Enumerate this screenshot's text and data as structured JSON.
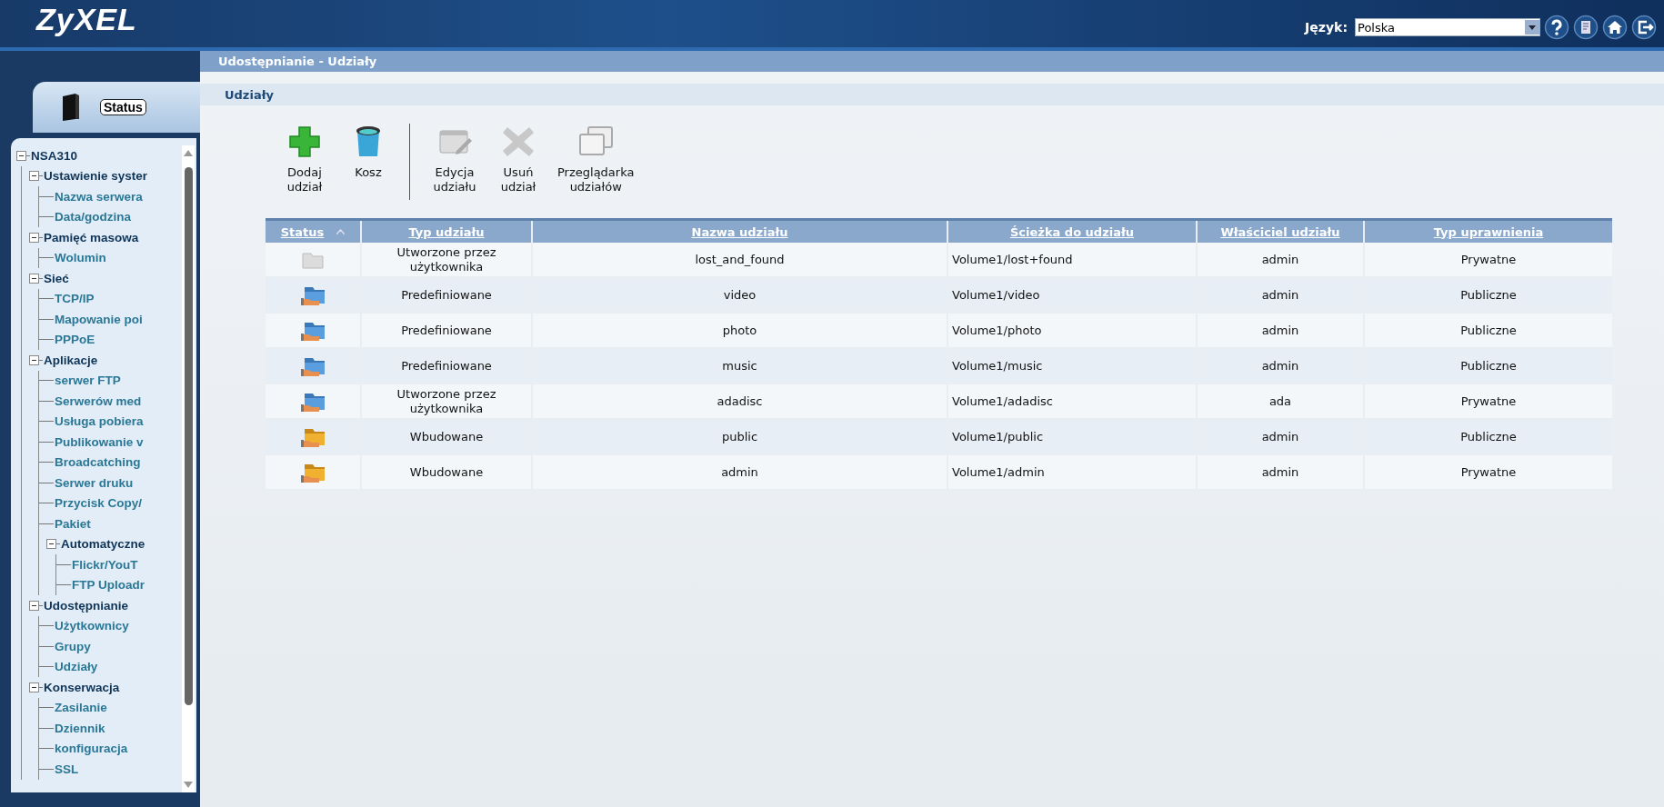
{
  "header": {
    "logo": "ZyXEL",
    "language_label": "Język:",
    "language_value": "Polska"
  },
  "sidebar": {
    "status_tab": "Status",
    "tree": [
      {
        "label": "NSA310",
        "expanded": true,
        "children": [
          {
            "label": "Ustawienie syster",
            "expanded": true,
            "children": [
              {
                "label": "Nazwa serwera"
              },
              {
                "label": "Data/godzina"
              }
            ]
          },
          {
            "label": "Pamięć masowa",
            "expanded": true,
            "children": [
              {
                "label": "Wolumin"
              }
            ]
          },
          {
            "label": "Sieć",
            "expanded": true,
            "children": [
              {
                "label": "TCP/IP"
              },
              {
                "label": "Mapowanie poi"
              },
              {
                "label": "PPPoE"
              }
            ]
          },
          {
            "label": "Aplikacje",
            "expanded": true,
            "children": [
              {
                "label": "serwer FTP"
              },
              {
                "label": "Serwerów med"
              },
              {
                "label": "Usługa pobiera"
              },
              {
                "label": "Publikowanie v"
              },
              {
                "label": "Broadcatching"
              },
              {
                "label": "Serwer druku"
              },
              {
                "label": "Przycisk Copy/"
              },
              {
                "label": "Pakiet"
              },
              {
                "label": "Automatyczne",
                "expanded": true,
                "children": [
                  {
                    "label": "Flickr/YouT"
                  },
                  {
                    "label": "FTP Uploadr"
                  }
                ]
              }
            ]
          },
          {
            "label": "Udostępnianie",
            "expanded": true,
            "children": [
              {
                "label": "Użytkownicy"
              },
              {
                "label": "Grupy"
              },
              {
                "label": "Udziały"
              }
            ]
          },
          {
            "label": "Konserwacja",
            "expanded": true,
            "children": [
              {
                "label": "Zasilanie"
              },
              {
                "label": "Dziennik"
              },
              {
                "label": "konfiguracja"
              },
              {
                "label": "SSL"
              }
            ]
          }
        ]
      }
    ]
  },
  "page_title": "Udostępnianie - Udziały",
  "section_title": "Udziały",
  "toolbar": {
    "groups": [
      [
        {
          "label": "Dodaj udział",
          "kind": "add",
          "disabled": false
        },
        {
          "label": "Kosz",
          "kind": "trash",
          "disabled": false
        }
      ],
      [
        {
          "label": "Edycja udziału",
          "kind": "edit",
          "disabled": true
        },
        {
          "label": "Usuń udział",
          "kind": "delete",
          "disabled": true
        },
        {
          "label": "Przeglądarka udziałów",
          "kind": "browser",
          "disabled": true
        }
      ]
    ]
  },
  "table": {
    "columns": [
      {
        "label": "Status",
        "sorted": true
      },
      {
        "label": "Typ udziału",
        "sorted": false
      },
      {
        "label": "Nazwa udziału",
        "sorted": false
      },
      {
        "label": "Ścieżka do udziału",
        "sorted": false
      },
      {
        "label": "Właściciel udziału",
        "sorted": false
      },
      {
        "label": "Typ uprawnienia",
        "sorted": false
      }
    ],
    "rows": [
      {
        "kind": "empty",
        "cells": [
          "",
          "Utworzone przez użytkownika",
          "lost_and_found",
          "Volume1/lost+found",
          "admin",
          "Prywatne"
        ]
      },
      {
        "kind": "shared",
        "cells": [
          "",
          "Predefiniowane",
          "video",
          "Volume1/video",
          "admin",
          "Publiczne"
        ]
      },
      {
        "kind": "shared",
        "cells": [
          "",
          "Predefiniowane",
          "photo",
          "Volume1/photo",
          "admin",
          "Publiczne"
        ]
      },
      {
        "kind": "shared",
        "cells": [
          "",
          "Predefiniowane",
          "music",
          "Volume1/music",
          "admin",
          "Publiczne"
        ]
      },
      {
        "kind": "shared",
        "cells": [
          "",
          "Utworzone przez użytkownika",
          "adadisc",
          "Volume1/adadisc",
          "ada",
          "Prywatne"
        ]
      },
      {
        "kind": "builtin",
        "cells": [
          "",
          "Wbudowane",
          "public",
          "Volume1/public",
          "admin",
          "Publiczne"
        ]
      },
      {
        "kind": "builtin",
        "cells": [
          "",
          "Wbudowane",
          "admin",
          "Volume1/admin",
          "admin",
          "Prywatne"
        ]
      }
    ]
  }
}
